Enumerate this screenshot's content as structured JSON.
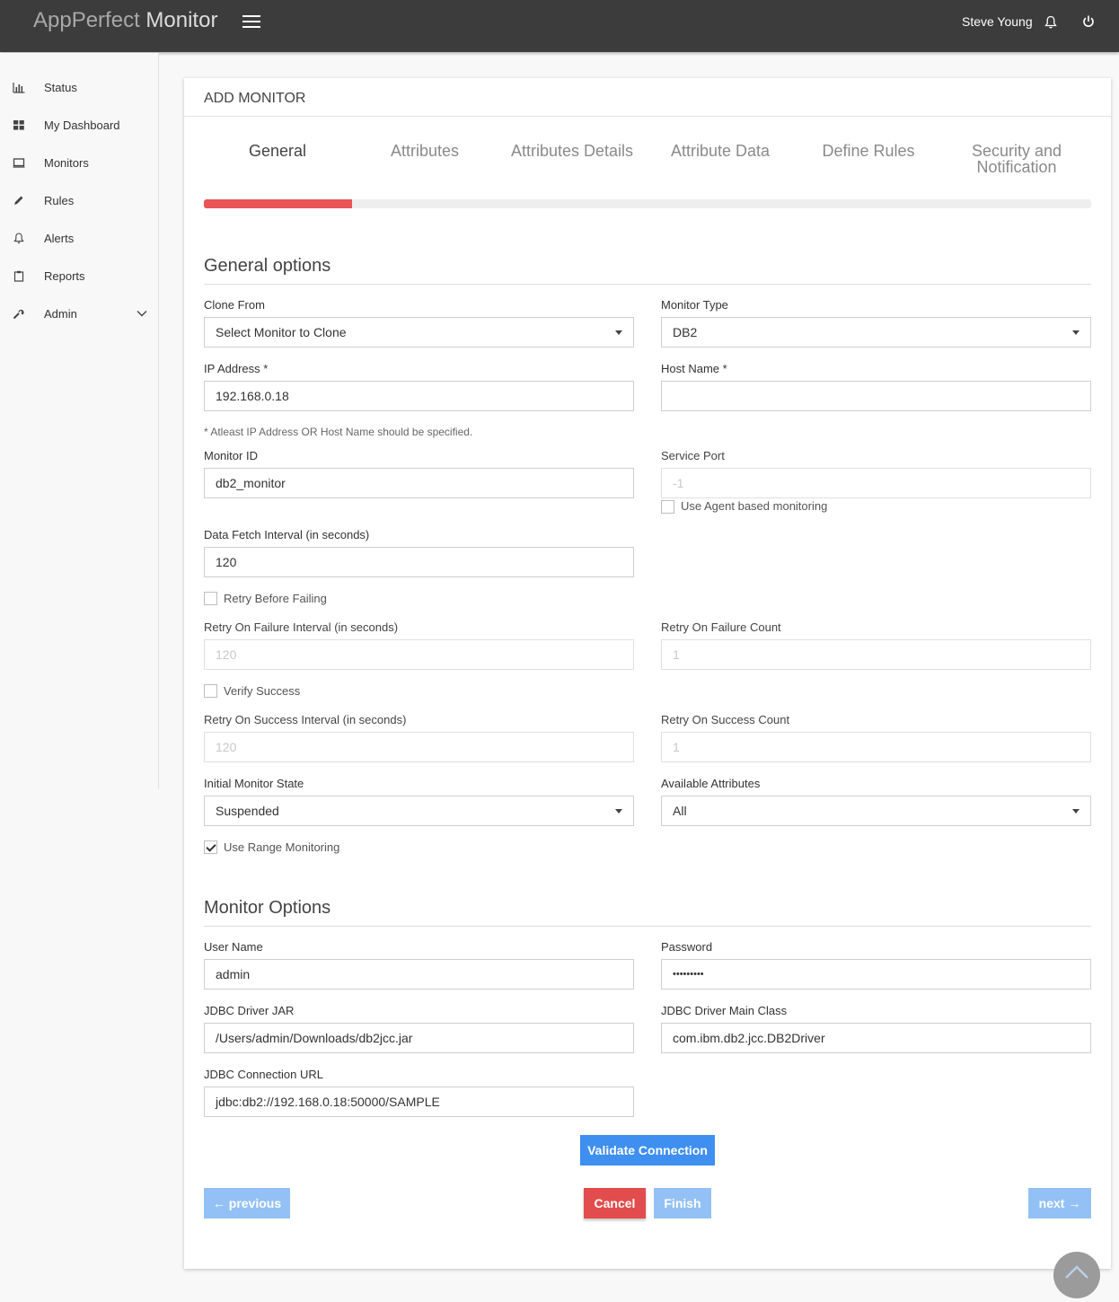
{
  "header": {
    "brand_light": "AppPerfect",
    "brand_strong": "Monitor",
    "user_name": "Steve Young"
  },
  "sidebar": {
    "items": [
      {
        "label": "Status",
        "icon": "bar-chart-icon"
      },
      {
        "label": "My Dashboard",
        "icon": "dashboard-grid-icon"
      },
      {
        "label": "Monitors",
        "icon": "monitor-icon"
      },
      {
        "label": "Rules",
        "icon": "pencil-icon"
      },
      {
        "label": "Alerts",
        "icon": "bell-icon"
      },
      {
        "label": "Reports",
        "icon": "clipboard-icon"
      },
      {
        "label": "Admin",
        "icon": "wrench-icon"
      }
    ]
  },
  "card": {
    "title": "ADD MONITOR",
    "steps": [
      "General",
      "Attributes",
      "Attributes Details",
      "Attribute Data",
      "Define Rules",
      "Security and Notification"
    ],
    "active_step": 0,
    "progress_fraction": 0.1667
  },
  "general": {
    "title": "General options",
    "clone_from": {
      "label": "Clone From",
      "value": "Select Monitor to Clone"
    },
    "monitor_type": {
      "label": "Monitor Type",
      "value": "DB2"
    },
    "ip_address": {
      "label": "IP Address *",
      "value": "192.168.0.18"
    },
    "host_name": {
      "label": "Host Name *",
      "value": ""
    },
    "hint": "* Atleast IP Address OR Host Name should be specified.",
    "monitor_id": {
      "label": "Monitor ID",
      "value": "db2_monitor"
    },
    "service_port": {
      "label": "Service Port",
      "value": "-1"
    },
    "agent_based": {
      "label": "Use Agent based monitoring",
      "checked": false
    },
    "fetch_interval": {
      "label": "Data Fetch Interval (in seconds)",
      "value": "120"
    },
    "retry_before_failing": {
      "label": "Retry Before Failing",
      "checked": false
    },
    "retry_failure_interval": {
      "label": "Retry On Failure Interval (in seconds)",
      "value": "120"
    },
    "retry_failure_count": {
      "label": "Retry On Failure Count",
      "value": "1"
    },
    "verify_success": {
      "label": "Verify Success",
      "checked": false
    },
    "retry_success_interval": {
      "label": "Retry On Success Interval (in seconds)",
      "value": "120"
    },
    "retry_success_count": {
      "label": "Retry On Success Count",
      "value": "1"
    },
    "initial_state": {
      "label": "Initial Monitor State",
      "value": "Suspended"
    },
    "available_attributes": {
      "label": "Available Attributes",
      "value": "All"
    },
    "range_monitoring": {
      "label": "Use Range Monitoring",
      "checked": true
    }
  },
  "monitor_options": {
    "title": "Monitor Options",
    "user_name": {
      "label": "User Name",
      "value": "admin"
    },
    "password": {
      "label": "Password",
      "value": "•••••••••"
    },
    "jdbc_jar": {
      "label": "JDBC Driver JAR",
      "value": "/Users/admin/Downloads/db2jcc.jar"
    },
    "jdbc_class": {
      "label": "JDBC Driver Main Class",
      "value": "com.ibm.db2.jcc.DB2Driver"
    },
    "jdbc_url": {
      "label": "JDBC Connection URL",
      "value": "jdbc:db2://192.168.0.18:50000/SAMPLE"
    }
  },
  "buttons": {
    "validate": "Validate Connection",
    "previous": "← previous",
    "cancel": "Cancel",
    "finish": "Finish",
    "next": "next →"
  },
  "colors": {
    "topbar": "#3c3c3c",
    "progress": "#e95454",
    "primary": "#3e8ff0",
    "primary_disabled": "#93c1f5",
    "danger": "#e34c4c"
  }
}
